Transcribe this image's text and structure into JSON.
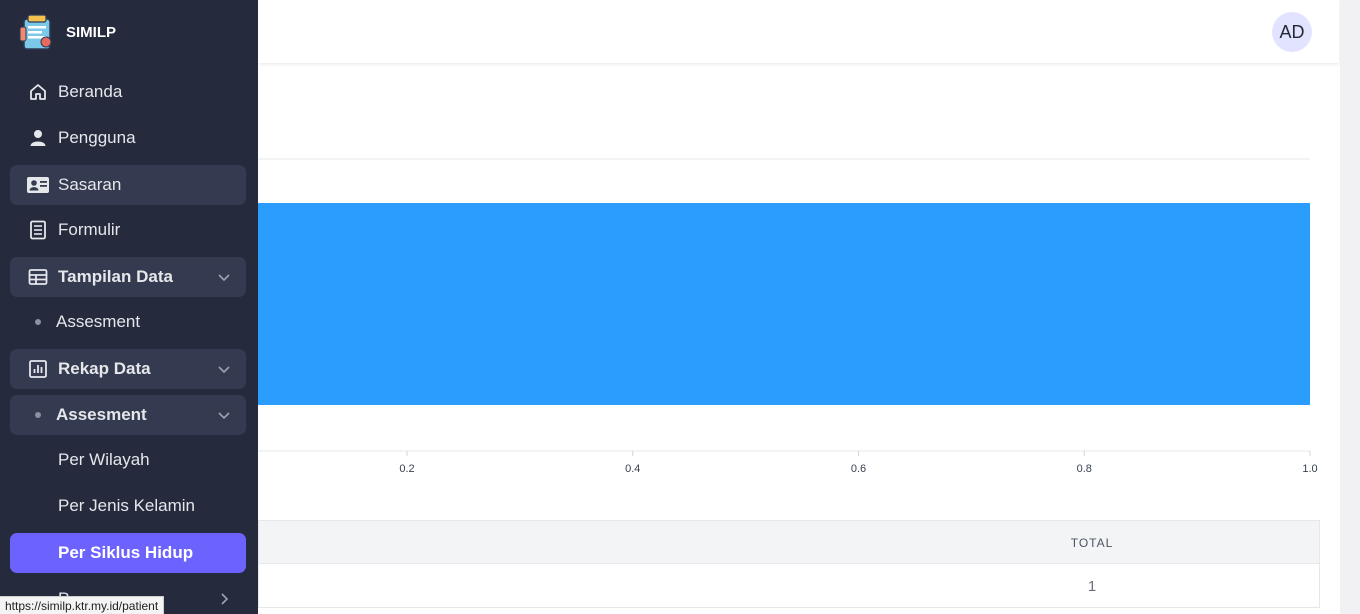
{
  "app": {
    "name": "SIMILP"
  },
  "user": {
    "initials": "AD"
  },
  "sidebar": {
    "items": [
      {
        "label": "Beranda",
        "icon": "home-icon"
      },
      {
        "label": "Pengguna",
        "icon": "user-icon"
      },
      {
        "label": "Sasaran",
        "icon": "id-card-icon"
      },
      {
        "label": "Formulir",
        "icon": "document-icon"
      },
      {
        "label": "Tampilan Data",
        "icon": "table-icon"
      },
      {
        "label": "Assesment",
        "icon": "dot-icon"
      },
      {
        "label": "Rekap Data",
        "icon": "bar-chart-icon"
      },
      {
        "label": "Assesment",
        "icon": "dot-icon"
      },
      {
        "label": "Per Wilayah"
      },
      {
        "label": "Per Jenis Kelamin"
      },
      {
        "label": "Per Siklus Hidup"
      },
      {
        "label": "P..."
      }
    ]
  },
  "chart_data": {
    "type": "bar",
    "orientation": "horizontal",
    "categories": [
      ""
    ],
    "values": [
      1
    ],
    "xlim": [
      0,
      1.0
    ],
    "x_ticks": [
      "0.2",
      "0.4",
      "0.6",
      "0.8",
      "1.0"
    ],
    "bar_color": "#2a9dfd",
    "grid": true
  },
  "table": {
    "headers": {
      "total": "TOTAL"
    },
    "rows": [
      {
        "total": "1"
      }
    ]
  },
  "status_bar": {
    "url": "https://similp.ktr.my.id/patient"
  },
  "colors": {
    "sidebar_bg": "#252a3d",
    "active": "#6c63ff",
    "accent_bar": "#2a9dfd"
  }
}
